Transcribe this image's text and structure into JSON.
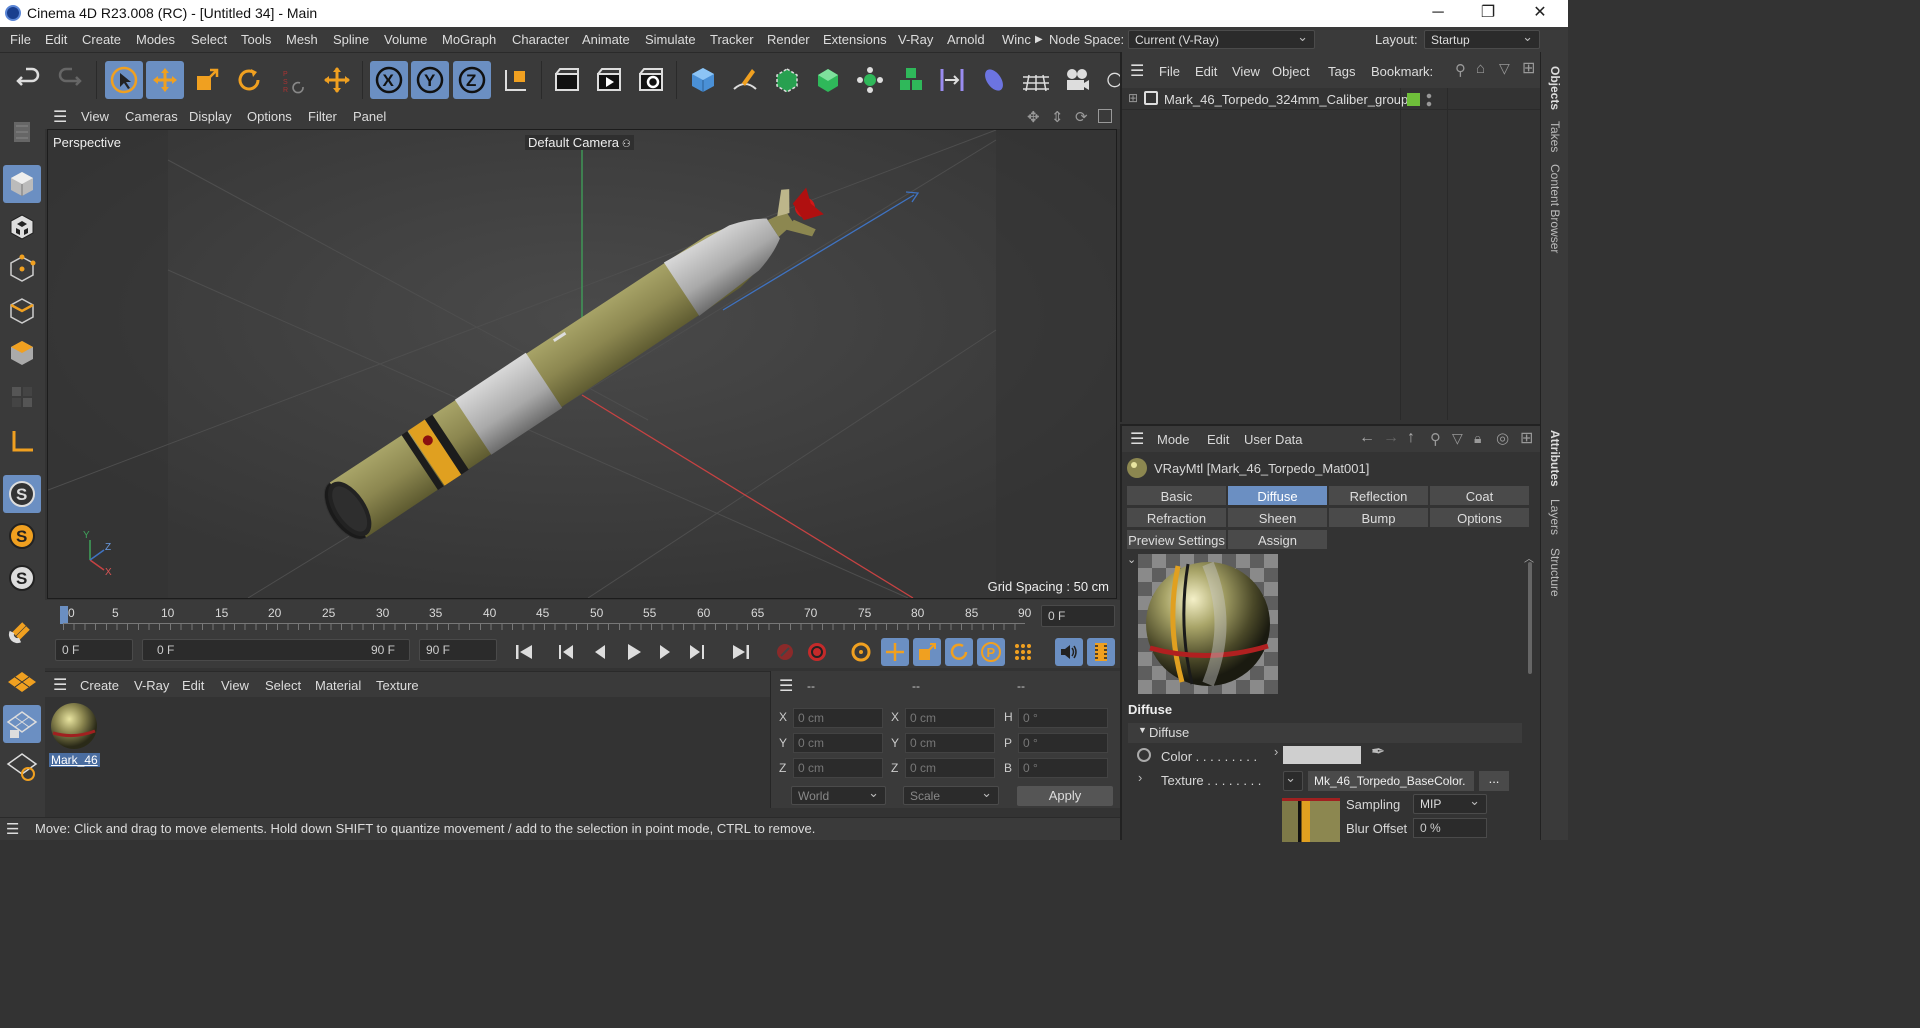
{
  "window": {
    "title": "Cinema 4D R23.008 (RC) - [Untitled 34] - Main",
    "controls": [
      "─",
      "❐",
      "✕"
    ]
  },
  "menubar": {
    "items": [
      "File",
      "Edit",
      "Create",
      "Modes",
      "Select",
      "Tools",
      "Mesh",
      "Spline",
      "Volume",
      "MoGraph",
      "Character",
      "Animate",
      "Simulate",
      "Tracker",
      "Render",
      "Extensions",
      "V-Ray",
      "Arnold",
      "Winc"
    ],
    "node_space_label": "Node Space:",
    "node_space_value": "Current (V-Ray)",
    "layout_label": "Layout:",
    "layout_value": "Startup"
  },
  "viewport_menu": {
    "items": [
      "View",
      "Cameras",
      "Display",
      "Options",
      "Filter",
      "Panel"
    ]
  },
  "viewport": {
    "projection": "Perspective",
    "camera": "Default Camera",
    "grid_spacing": "Grid Spacing : 50 cm",
    "axis_x": "X",
    "axis_y": "Y",
    "axis_z": "Z"
  },
  "timeline": {
    "ticks": [
      "0",
      "5",
      "10",
      "15",
      "20",
      "25",
      "30",
      "35",
      "40",
      "45",
      "50",
      "55",
      "60",
      "65",
      "70",
      "75",
      "80",
      "85",
      "90"
    ],
    "current_frame_field": "0 F",
    "start_field": "0 F",
    "range_start": "0 F",
    "range_end": "90 F",
    "end_field": "90 F"
  },
  "material_manager": {
    "menu": [
      "Create",
      "V-Ray",
      "Edit",
      "View",
      "Select",
      "Material",
      "Texture"
    ],
    "materials": [
      {
        "name": "Mark_46"
      }
    ]
  },
  "coordinates": {
    "headers": [
      "--",
      "--",
      "--"
    ],
    "rows": [
      {
        "l1": "X",
        "v1": "0 cm",
        "l2": "X",
        "v2": "0 cm",
        "l3": "H",
        "v3": "0 °"
      },
      {
        "l1": "Y",
        "v1": "0 cm",
        "l2": "Y",
        "v2": "0 cm",
        "l3": "P",
        "v3": "0 °"
      },
      {
        "l1": "Z",
        "v1": "0 cm",
        "l2": "Z",
        "v2": "0 cm",
        "l3": "B",
        "v3": "0 °"
      }
    ],
    "mode_select": "World",
    "scale_select": "Scale",
    "apply_label": "Apply"
  },
  "status": {
    "text": "Move: Click and drag to move elements. Hold down SHIFT to quantize movement / add to the selection in point mode, CTRL to remove."
  },
  "object_manager": {
    "menu": [
      "File",
      "Edit",
      "View",
      "Object",
      "Tags",
      "Bookmark:"
    ],
    "objects": [
      {
        "name": "Mark_46_Torpedo_324mm_Caliber_group"
      }
    ]
  },
  "attributes": {
    "menu": [
      "Mode",
      "Edit",
      "User Data"
    ],
    "material_title": "VRayMtl [Mark_46_Torpedo_Mat001]",
    "tabs_row1": [
      "Basic",
      "Diffuse",
      "Reflection",
      "Coat"
    ],
    "tabs_row2": [
      "Refraction",
      "Sheen",
      "Bump",
      "Options"
    ],
    "tabs_row3": [
      "Preview Settings",
      "Assign"
    ],
    "active_tab": "Diffuse",
    "section_title": "Diffuse",
    "group_title": "Diffuse",
    "color_label": "Color . . . . . . . . .",
    "texture_label": "Texture . . . . . . . .",
    "texture_value": "Mk_46_Torpedo_BaseColor.",
    "texture_more": "...",
    "sampling_label": "Sampling",
    "sampling_value": "MIP",
    "blur_label": "Blur Offset",
    "blur_value": "0 %"
  },
  "right_tabs": {
    "top": [
      "Objects",
      "Takes",
      "Content Browser"
    ],
    "bottom": [
      "Attributes",
      "Layers",
      "Structure"
    ]
  },
  "colors": {
    "accent": "#6b8fc2",
    "torpedo_body": "#8c8750",
    "torpedo_band": "#e0a020"
  }
}
